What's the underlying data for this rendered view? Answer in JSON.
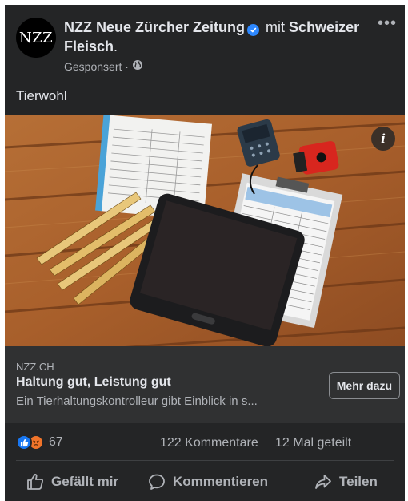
{
  "post": {
    "author": "NZZ Neue Zürcher Zeitung",
    "connector": "mit",
    "partner": "Schweizer Fleisch",
    "period": ".",
    "avatar_text": "NZZ",
    "meta": "Gesponsert ·",
    "text": "Tierwohl",
    "more_icon": "•••"
  },
  "link_preview": {
    "domain": "NZZ.CH",
    "title": "Haltung gut, Leistung gut",
    "description": "Ein Tierhaltungskontrolleur gibt Einblick in s...",
    "button": "Mehr dazu"
  },
  "stats": {
    "reaction_count": "67",
    "comments": "122 Kommentare",
    "shares": "12 Mal geteilt"
  },
  "actions": {
    "like": "Gefällt mir",
    "comment": "Kommentieren",
    "share": "Teilen"
  },
  "image": {
    "info_icon": "i"
  },
  "colors": {
    "background": "#242526",
    "link_bg": "#303132",
    "accent": "#2d88ff"
  }
}
